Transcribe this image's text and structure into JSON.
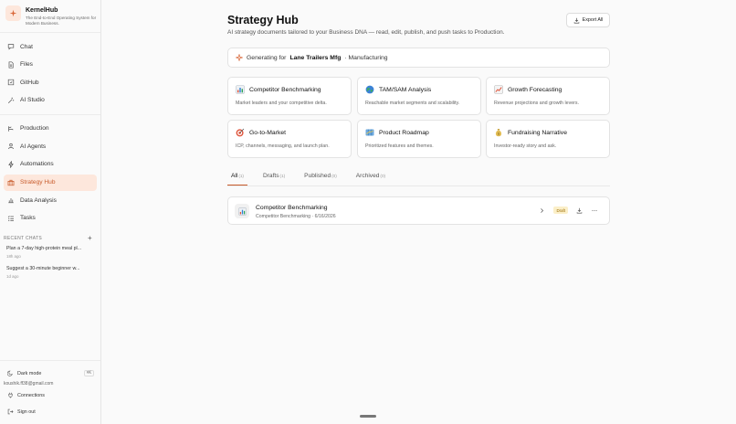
{
  "brand": {
    "title": "KernelHub",
    "subtitle": "The End-to-End Operating System for Modern Business."
  },
  "nav_primary": [
    {
      "label": "Chat",
      "icon": "chat-icon"
    },
    {
      "label": "Files",
      "icon": "file-icon"
    },
    {
      "label": "GitHub",
      "icon": "github-icon"
    },
    {
      "label": "AI Studio",
      "icon": "ai-studio-icon"
    }
  ],
  "nav_secondary": [
    {
      "label": "Production",
      "icon": "production-icon"
    },
    {
      "label": "AI Agents",
      "icon": "agent-icon"
    },
    {
      "label": "Automations",
      "icon": "bolt-icon"
    },
    {
      "label": "Strategy Hub",
      "icon": "briefcase-icon",
      "active": true
    },
    {
      "label": "Data Analysis",
      "icon": "bar-chart-icon"
    },
    {
      "label": "Tasks",
      "icon": "tasks-icon"
    }
  ],
  "recent": {
    "heading": "RECENT CHATS",
    "items": [
      {
        "title": "Plan a 7-day high-protein meal pl...",
        "time": "18h ago"
      },
      {
        "title": "Suggest a 30-minute beginner w...",
        "time": "1d ago"
      }
    ]
  },
  "sidebar_bottom": {
    "dark_mode_label": "Dark mode",
    "dark_mode_shortcut": "⌘K",
    "email": "koushik.ff38@gmail.com",
    "connections_label": "Connections",
    "sign_out_label": "Sign out"
  },
  "page": {
    "title": "Strategy Hub",
    "subtitle": "AI strategy documents tailored to your Business DNA — read, edit, publish, and push tasks to Production.",
    "export_label": "Export All",
    "generating_prefix": "Generating for",
    "company": "Lane Trailers Mfg",
    "industry": "· Manufacturing"
  },
  "cards": [
    {
      "title": "Competitor Benchmarking",
      "desc": "Market leaders and your competitive delta.",
      "icon": "bar-chart-emoji"
    },
    {
      "title": "TAM/SAM Analysis",
      "desc": "Reachable market segments and scalability.",
      "icon": "globe-emoji"
    },
    {
      "title": "Growth Forecasting",
      "desc": "Revenue projections and growth levers.",
      "icon": "trend-up-emoji"
    },
    {
      "title": "Go-to-Market",
      "desc": "ICP, channels, messaging, and launch plan.",
      "icon": "target-emoji"
    },
    {
      "title": "Product Roadmap",
      "desc": "Prioritized features and themes.",
      "icon": "map-emoji"
    },
    {
      "title": "Fundraising Narrative",
      "desc": "Investor-ready story and ask.",
      "icon": "money-bag-emoji"
    }
  ],
  "tabs": [
    {
      "label": "All",
      "count": "(1)",
      "active": true
    },
    {
      "label": "Drafts",
      "count": "(1)"
    },
    {
      "label": "Published",
      "count": "(0)"
    },
    {
      "label": "Archived",
      "count": "(0)"
    }
  ],
  "documents": [
    {
      "title": "Competitor Benchmarking",
      "meta": "Competitor Benchmarking · 6/16/2026",
      "status": "Draft"
    }
  ],
  "colors": {
    "accent": "#c85a2a",
    "accent_bg": "#fde7dc",
    "draft_badge": "#fbefc8"
  }
}
